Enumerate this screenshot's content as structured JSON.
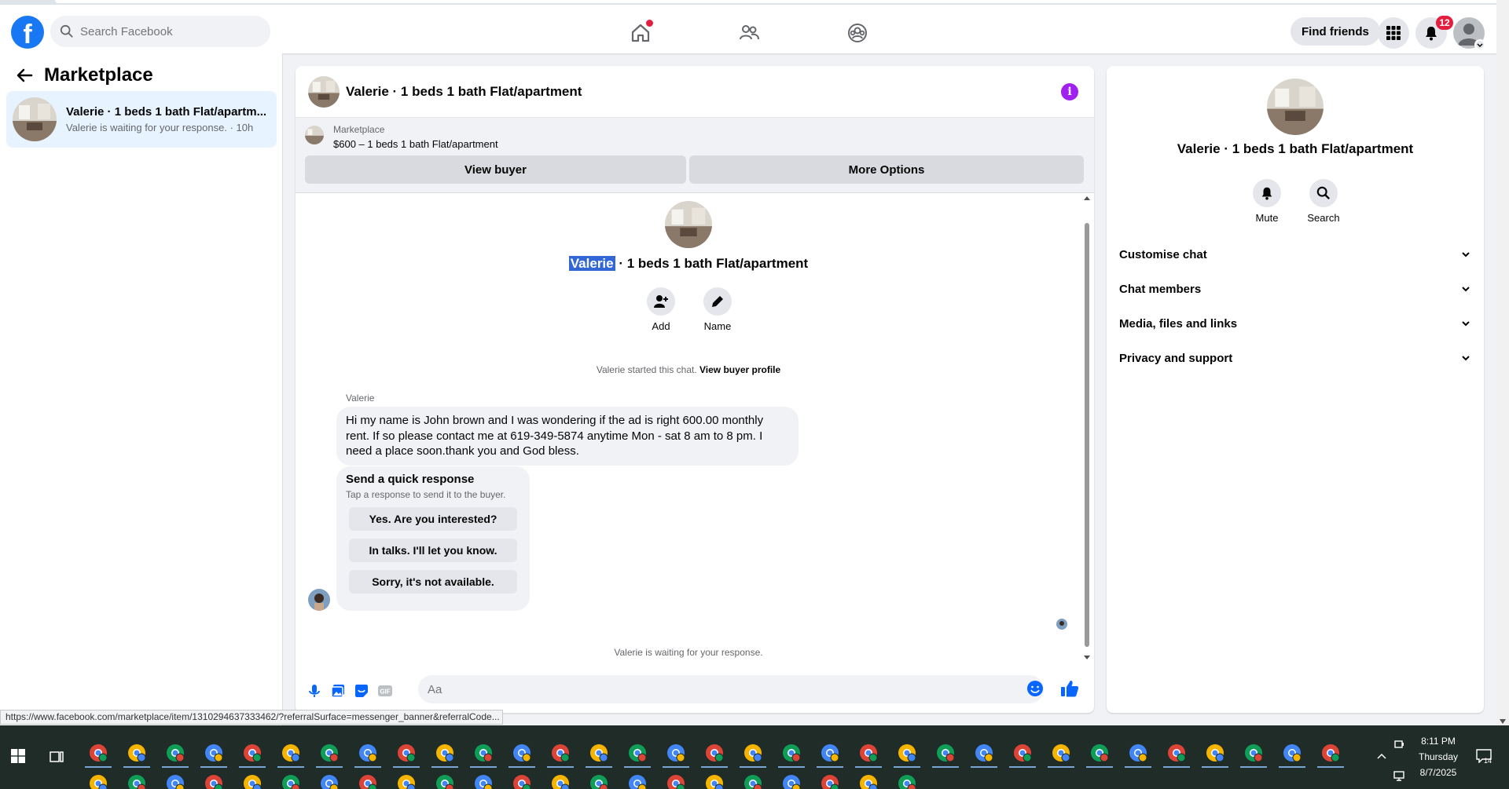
{
  "header": {
    "search_placeholder": "Search Facebook",
    "find_friends_label": "Find friends",
    "notification_count": "12"
  },
  "left": {
    "title": "Marketplace",
    "thread": {
      "title": "Valerie · 1 beds 1 bath Flat/apartm...",
      "subtitle": "Valerie is waiting for your response. · 10h"
    }
  },
  "chat": {
    "title": "Valerie · 1 beds 1 bath Flat/apartment",
    "banner": {
      "label": "Marketplace",
      "listing": "$600 – 1 beds 1 bath Flat/apartment",
      "view_buyer_label": "View buyer",
      "more_options_label": "More Options"
    },
    "center": {
      "name_selected": "Valerie",
      "name_rest": " · 1 beds 1 bath Flat/apartment",
      "add_label": "Add",
      "name_label": "Name"
    },
    "started_text": "Valerie started this chat.",
    "view_buyer_profile": "View buyer profile",
    "sender": "Valerie",
    "message": "Hi my name is John brown and I was wondering if the ad is right 600.00 monthly rent. If so please contact me at 619-349-5874 anytime Mon - sat 8 am to 8 pm. I need a place soon.thank you and God bless.",
    "quick": {
      "title": "Send a quick response",
      "subtitle": "Tap a response to send it to the buyer.",
      "options": [
        "Yes. Are you interested?",
        "In talks. I'll let you know.",
        "Sorry, it's not available."
      ]
    },
    "waiting": "Valerie is waiting for your response.",
    "composer_placeholder": "Aa",
    "gif_label": "GIF"
  },
  "right": {
    "title": "Valerie · 1 beds 1 bath Flat/apartment",
    "mute_label": "Mute",
    "search_label": "Search",
    "rows": [
      "Customise chat",
      "Chat members",
      "Media, files and links",
      "Privacy and support"
    ]
  },
  "status_url": "https://www.facebook.com/marketplace/item/1310294637333462/?referralSurface=messenger_banner&referralCode...",
  "taskbar": {
    "time": "8:11 PM",
    "day": "Thursday",
    "date": "8/7/2025",
    "notif_count": "14"
  },
  "colors": {
    "facebook_blue": "#1877f2",
    "badge_red": "#e41e3f",
    "info_purple": "#a020f0",
    "selected_thread_bg": "#e7f3ff",
    "taskbar_bg": "#202c27"
  }
}
